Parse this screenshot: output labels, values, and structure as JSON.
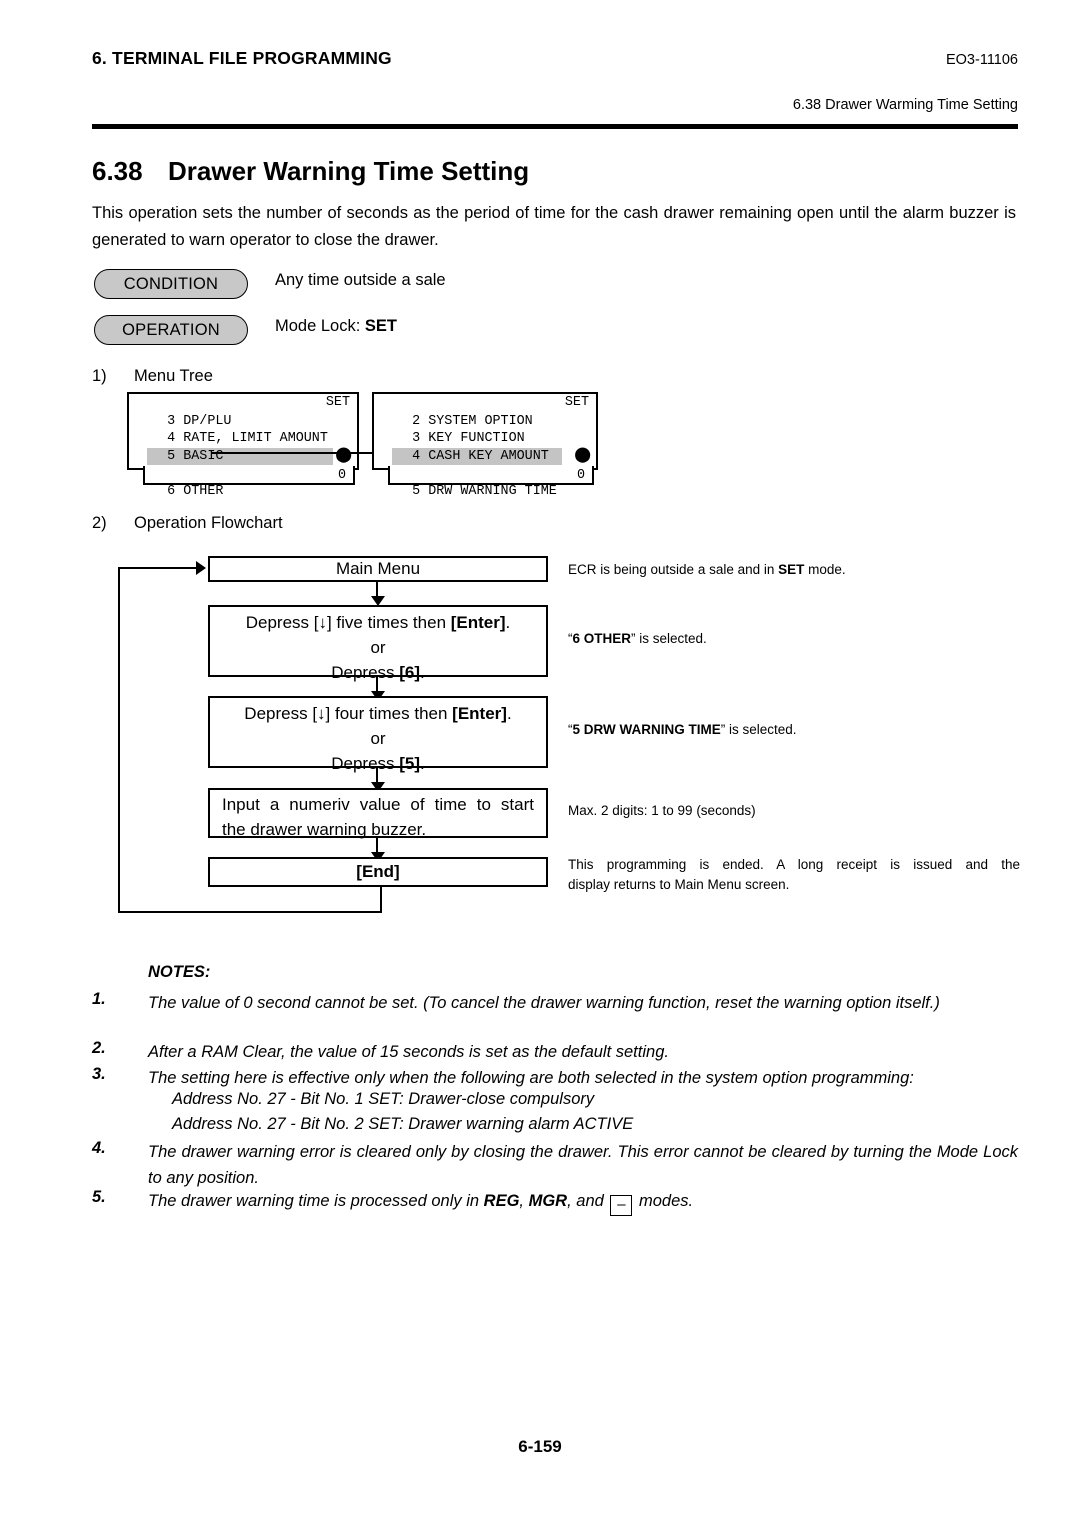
{
  "header": {
    "chapter": "6. TERMINAL FILE PROGRAMMING",
    "doc_code": "EO3-11106",
    "running_head": "6.38 Drawer Warming Time Setting"
  },
  "title": {
    "number": "6.38",
    "text": "Drawer Warning Time Setting"
  },
  "intro": "This operation sets the number of seconds as the period of time for the cash drawer remaining open until the alarm buzzer is generated to warn operator to close the drawer.",
  "condition": {
    "label": "CONDITION",
    "value": "Any time outside a sale"
  },
  "operation": {
    "label": "OPERATION",
    "value_prefix": "Mode Lock:",
    "value_bold": "SET"
  },
  "sections": {
    "menu_tree": {
      "num": "1)",
      "label": "Menu Tree"
    },
    "flowchart": {
      "num": "2)",
      "label": "Operation Flowchart"
    }
  },
  "menu_tree": {
    "left_screen": {
      "rows": [
        {
          "text": "3 DP/PLU",
          "right": "SET",
          "highlight": false
        },
        {
          "text": "4 RATE, LIMIT AMOUNT",
          "right": "",
          "highlight": false
        },
        {
          "text": "5 BASIC",
          "right": "",
          "highlight": false
        },
        {
          "text": "6 OTHER",
          "right": "",
          "highlight": true,
          "arrow": "updown-arrow-icon"
        }
      ],
      "footer_value": "0"
    },
    "right_screen": {
      "rows": [
        {
          "text": "2 SYSTEM OPTION",
          "right": "SET",
          "highlight": false
        },
        {
          "text": "3 KEY FUNCTION",
          "right": "",
          "highlight": false
        },
        {
          "text": "4 CASH KEY AMOUNT",
          "right": "",
          "highlight": false
        },
        {
          "text": "5 DRW WARNING TIME",
          "right": "",
          "highlight": true,
          "arrow": "updown-arrow-icon"
        }
      ],
      "footer_value": "0"
    }
  },
  "flowchart": {
    "boxes": [
      {
        "id": "main-menu",
        "lines": [
          "Main Menu"
        ],
        "bold": false
      },
      {
        "id": "depress-six",
        "line1_a": "Depress [",
        "line1_arrow": "↓",
        "line1_b": "] five times then ",
        "line1_key": "[Enter]",
        "line1_c": ".",
        "line2": "or",
        "line3_a": "Depress ",
        "line3_key": "[6]",
        "line3_b": "."
      },
      {
        "id": "depress-five",
        "line1_a": "Depress [",
        "line1_arrow": "↓",
        "line1_b": "] four times then ",
        "line1_key": "[Enter]",
        "line1_c": ".",
        "line2": "or",
        "line3_a": "Depress ",
        "line3_key": "[5]",
        "line3_b": "."
      },
      {
        "id": "input-value",
        "line1": "Input a numeriv value of time to start",
        "line2": "the drawer warning buzzer."
      },
      {
        "id": "end",
        "lines": [
          "[End]"
        ],
        "bold": true
      }
    ],
    "annotations": [
      {
        "id": "annot-main-menu",
        "a": "ECR is being outside a sale and in ",
        "bold": "SET",
        "b": " mode."
      },
      {
        "id": "annot-other",
        "a": "“",
        "bold": "6 OTHER",
        "b": "” is selected."
      },
      {
        "id": "annot-drw",
        "a": "“",
        "bold": "5 DRW WARNING TIME",
        "b": "” is selected."
      },
      {
        "id": "annot-max-digits",
        "a": "Max. 2 digits: 1 to 99 (seconds)",
        "bold": "",
        "b": ""
      },
      {
        "id": "annot-end",
        "line1": "This programming is ended.   A long receipt is issued and the",
        "line2": "display returns to Main Menu screen."
      }
    ]
  },
  "notes": {
    "title": "NOTES:",
    "items": [
      {
        "num": "1.",
        "text": "The value of 0 second cannot be set. (To cancel the drawer warning function, reset the warning option itself.)"
      },
      {
        "num": "2.",
        "text": "After a RAM Clear, the value of 15 seconds is set as the default setting."
      },
      {
        "num": "3.",
        "text": "The setting here is effective only when the following are both selected in the system option programming:",
        "sub": [
          "Address No. 27 - Bit No. 1 SET: Drawer-close compulsory",
          "Address No. 27 - Bit No. 2 SET: Drawer warning alarm ACTIVE"
        ]
      },
      {
        "num": "4.",
        "text": "The drawer warning error is cleared only by closing the drawer.  This error cannot be cleared by turning the Mode Lock to any position."
      },
      {
        "num": "5.",
        "text_a": "The drawer warning time is processed only in ",
        "bold1": "REG",
        "sep1": ", ",
        "bold2": "MGR",
        "sep2": ", and ",
        "keybox": "–",
        "text_b": " modes."
      }
    ]
  },
  "footer": {
    "page": "6-159"
  }
}
